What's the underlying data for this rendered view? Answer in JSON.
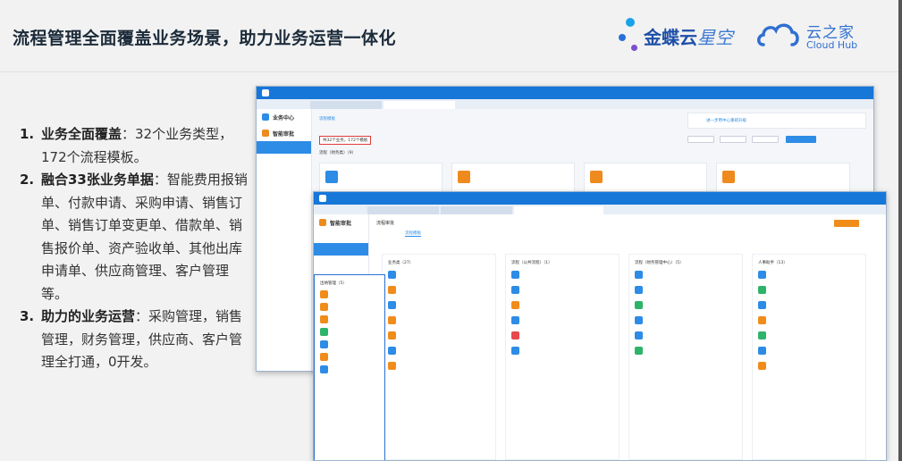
{
  "slide": {
    "title": "流程管理全面覆盖业务场景，助力业务运营一体化"
  },
  "logos": {
    "kingdee_main": "金蝶云",
    "kingdee_sub": "星空",
    "yzj_cn": "云之家",
    "yzj_en": "Cloud Hub"
  },
  "bullets": [
    {
      "num": "1.",
      "head": "业务全面覆盖",
      "body": "：32个业务类型，172个流程模板。"
    },
    {
      "num": "2.",
      "head": "融合33张业务单据",
      "body": "：智能费用报销单、付款申请、采购申请、销售订单、销售订单变更单、借款单、销售报价单、资产验收单、其他出库申请单、供应商管理、客户管理等。"
    },
    {
      "num": "3.",
      "head": "助力的业务运营",
      "body": "：采购管理，销售管理，财务管理，供应商、客户管理全打通，0开发。"
    }
  ],
  "window1": {
    "app_title": "智能审批",
    "section": "业务中心",
    "tab_active": "流程模板",
    "highlight": "共32个业务，172个模板",
    "group_label": "流程（财务类）（9）",
    "banner": "进一步用中心重磅升级"
  },
  "window2": {
    "app_title": "智能审批",
    "header": "流程审批",
    "tab_active": "流程模板",
    "col_headers": [
      "业务类（27）",
      "流程（公共流程）（1）",
      "流程（财务管理中心）（5）",
      "人事助手（13）"
    ],
    "float_header": "出纳管理（5）"
  },
  "colors": {
    "brand_blue": "#1677d9",
    "accent_orange": "#ef8a1e",
    "highlight_red": "#e23b3b"
  }
}
